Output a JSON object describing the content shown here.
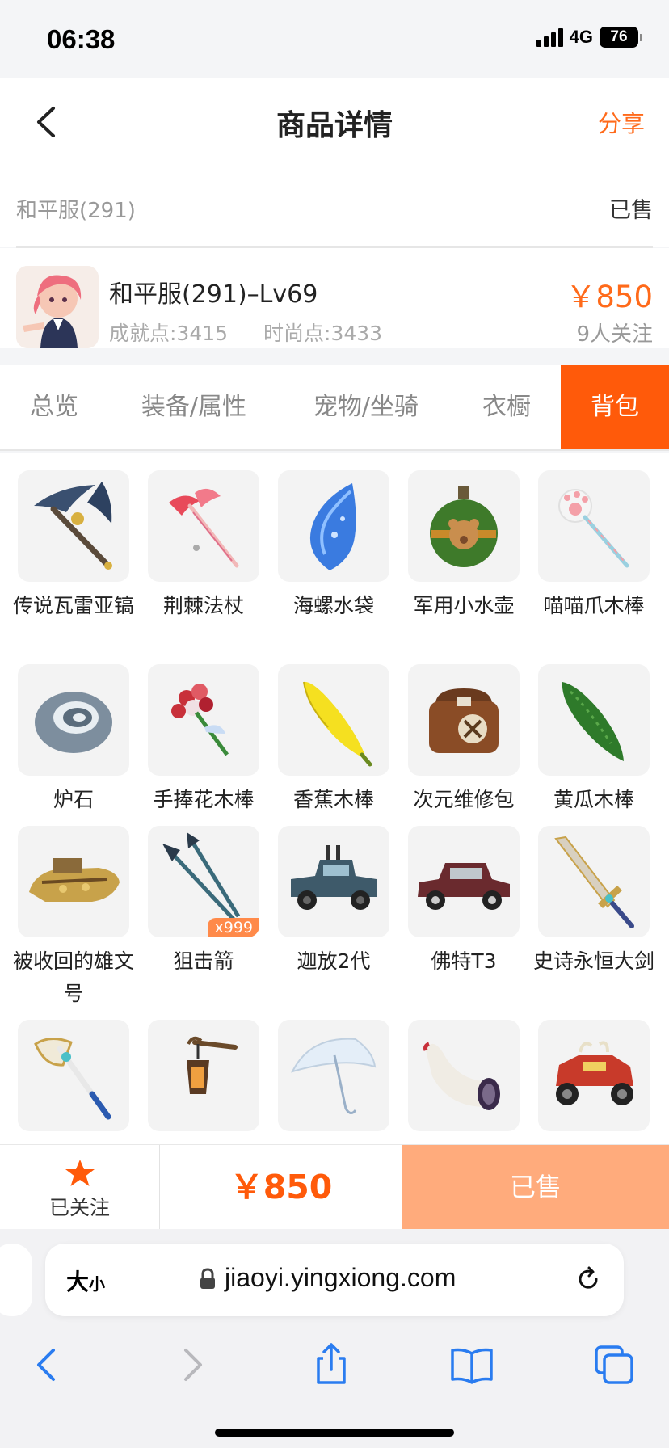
{
  "status_bar": {
    "time": "06:38",
    "network": "4G",
    "battery": "76"
  },
  "header": {
    "title": "商品详情",
    "share_label": "分享"
  },
  "server_row": {
    "server": "和平服(291)",
    "status": "已售"
  },
  "product": {
    "title": "和平服(291)–Lv69",
    "achievement": "成就点:3415",
    "fashion": "时尚点:3433",
    "price": "￥850",
    "followers": "9人关注"
  },
  "tabs": [
    {
      "label": "总览"
    },
    {
      "label": "装备/属性"
    },
    {
      "label": "宠物/坐骑"
    },
    {
      "label": "衣橱"
    },
    {
      "label": "背包",
      "active": true
    }
  ],
  "items": [
    {
      "name": "传说瓦雷亚镐",
      "icon": "pickaxe-icon"
    },
    {
      "name": "荆棘法杖",
      "icon": "staff-icon"
    },
    {
      "name": "海螺水袋",
      "icon": "conch-icon"
    },
    {
      "name": "军用小水壶",
      "icon": "canteen-icon"
    },
    {
      "name": "喵喵爪木棒",
      "icon": "paw-wand-icon"
    },
    {
      "name": "炉石",
      "icon": "hearthstone-icon"
    },
    {
      "name": "手捧花木棒",
      "icon": "bouquet-icon"
    },
    {
      "name": "香蕉木棒",
      "icon": "banana-icon"
    },
    {
      "name": "次元维修包",
      "icon": "repair-bag-icon"
    },
    {
      "name": "黄瓜木棒",
      "icon": "cucumber-icon"
    },
    {
      "name": "被收回的雄文号",
      "icon": "ship-icon"
    },
    {
      "name": "狙击箭",
      "icon": "arrows-icon",
      "qty": "x999"
    },
    {
      "name": "迦放2代",
      "icon": "truck-icon"
    },
    {
      "name": "佛特T3",
      "icon": "car-icon"
    },
    {
      "name": "史诗永恒大剑",
      "icon": "sword-icon"
    },
    {
      "name": "",
      "icon": "axe-icon"
    },
    {
      "name": "",
      "icon": "lantern-icon"
    },
    {
      "name": "",
      "icon": "umbrella-icon"
    },
    {
      "name": "",
      "icon": "horn-icon"
    },
    {
      "name": "",
      "icon": "monster-car-icon"
    }
  ],
  "bottom_bar": {
    "follow_label": "已关注",
    "price": "￥850",
    "sold_label": "已售"
  },
  "browser": {
    "text_size_big": "大",
    "text_size_small": "小",
    "url": "jiaoyi.yingxiong.com"
  },
  "colors": {
    "accent": "#ff5a0a",
    "price": "#ff6a1a",
    "sold_button": "#ffab7c"
  }
}
